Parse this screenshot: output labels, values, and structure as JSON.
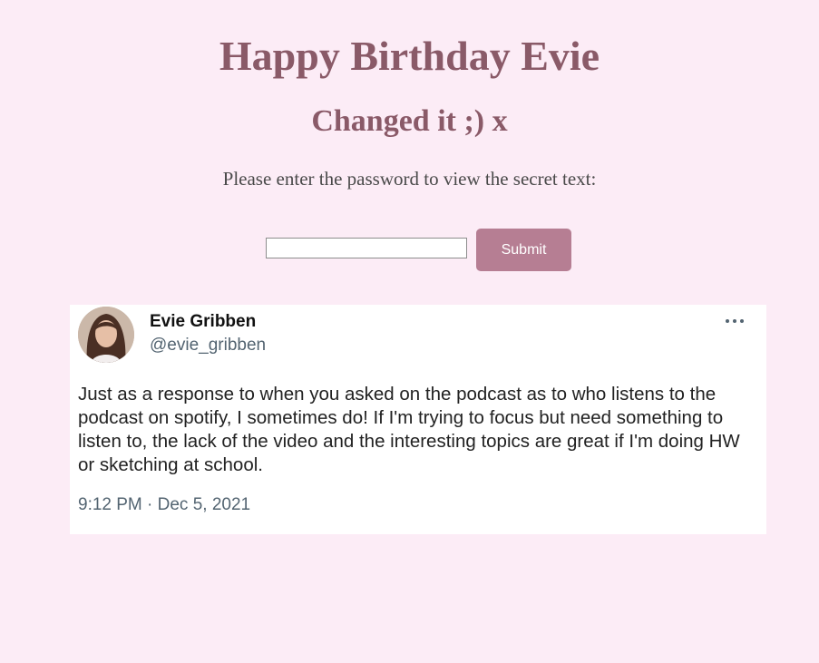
{
  "page": {
    "title": "Happy Birthday Evie",
    "subtitle": "Changed it ;) x",
    "prompt": "Please enter the password to view the secret text:"
  },
  "form": {
    "password_value": "",
    "submit_label": "Submit"
  },
  "tweet": {
    "display_name": "Evie Gribben",
    "handle": "@evie_gribben",
    "text": "Just as a response to when you asked on the podcast as to who listens to the podcast on spotify, I sometimes do! If I'm trying to focus but need something to listen to, the lack of the video and the interesting topics are great if I'm doing HW or sketching at school.",
    "timestamp": "9:12 PM · Dec 5, 2021",
    "menu_icon": "more-horizontal-icon"
  },
  "colors": {
    "background": "#fcecf6",
    "heading": "#8a5a68",
    "button": "#b67e93",
    "secondary_text": "#536471"
  }
}
